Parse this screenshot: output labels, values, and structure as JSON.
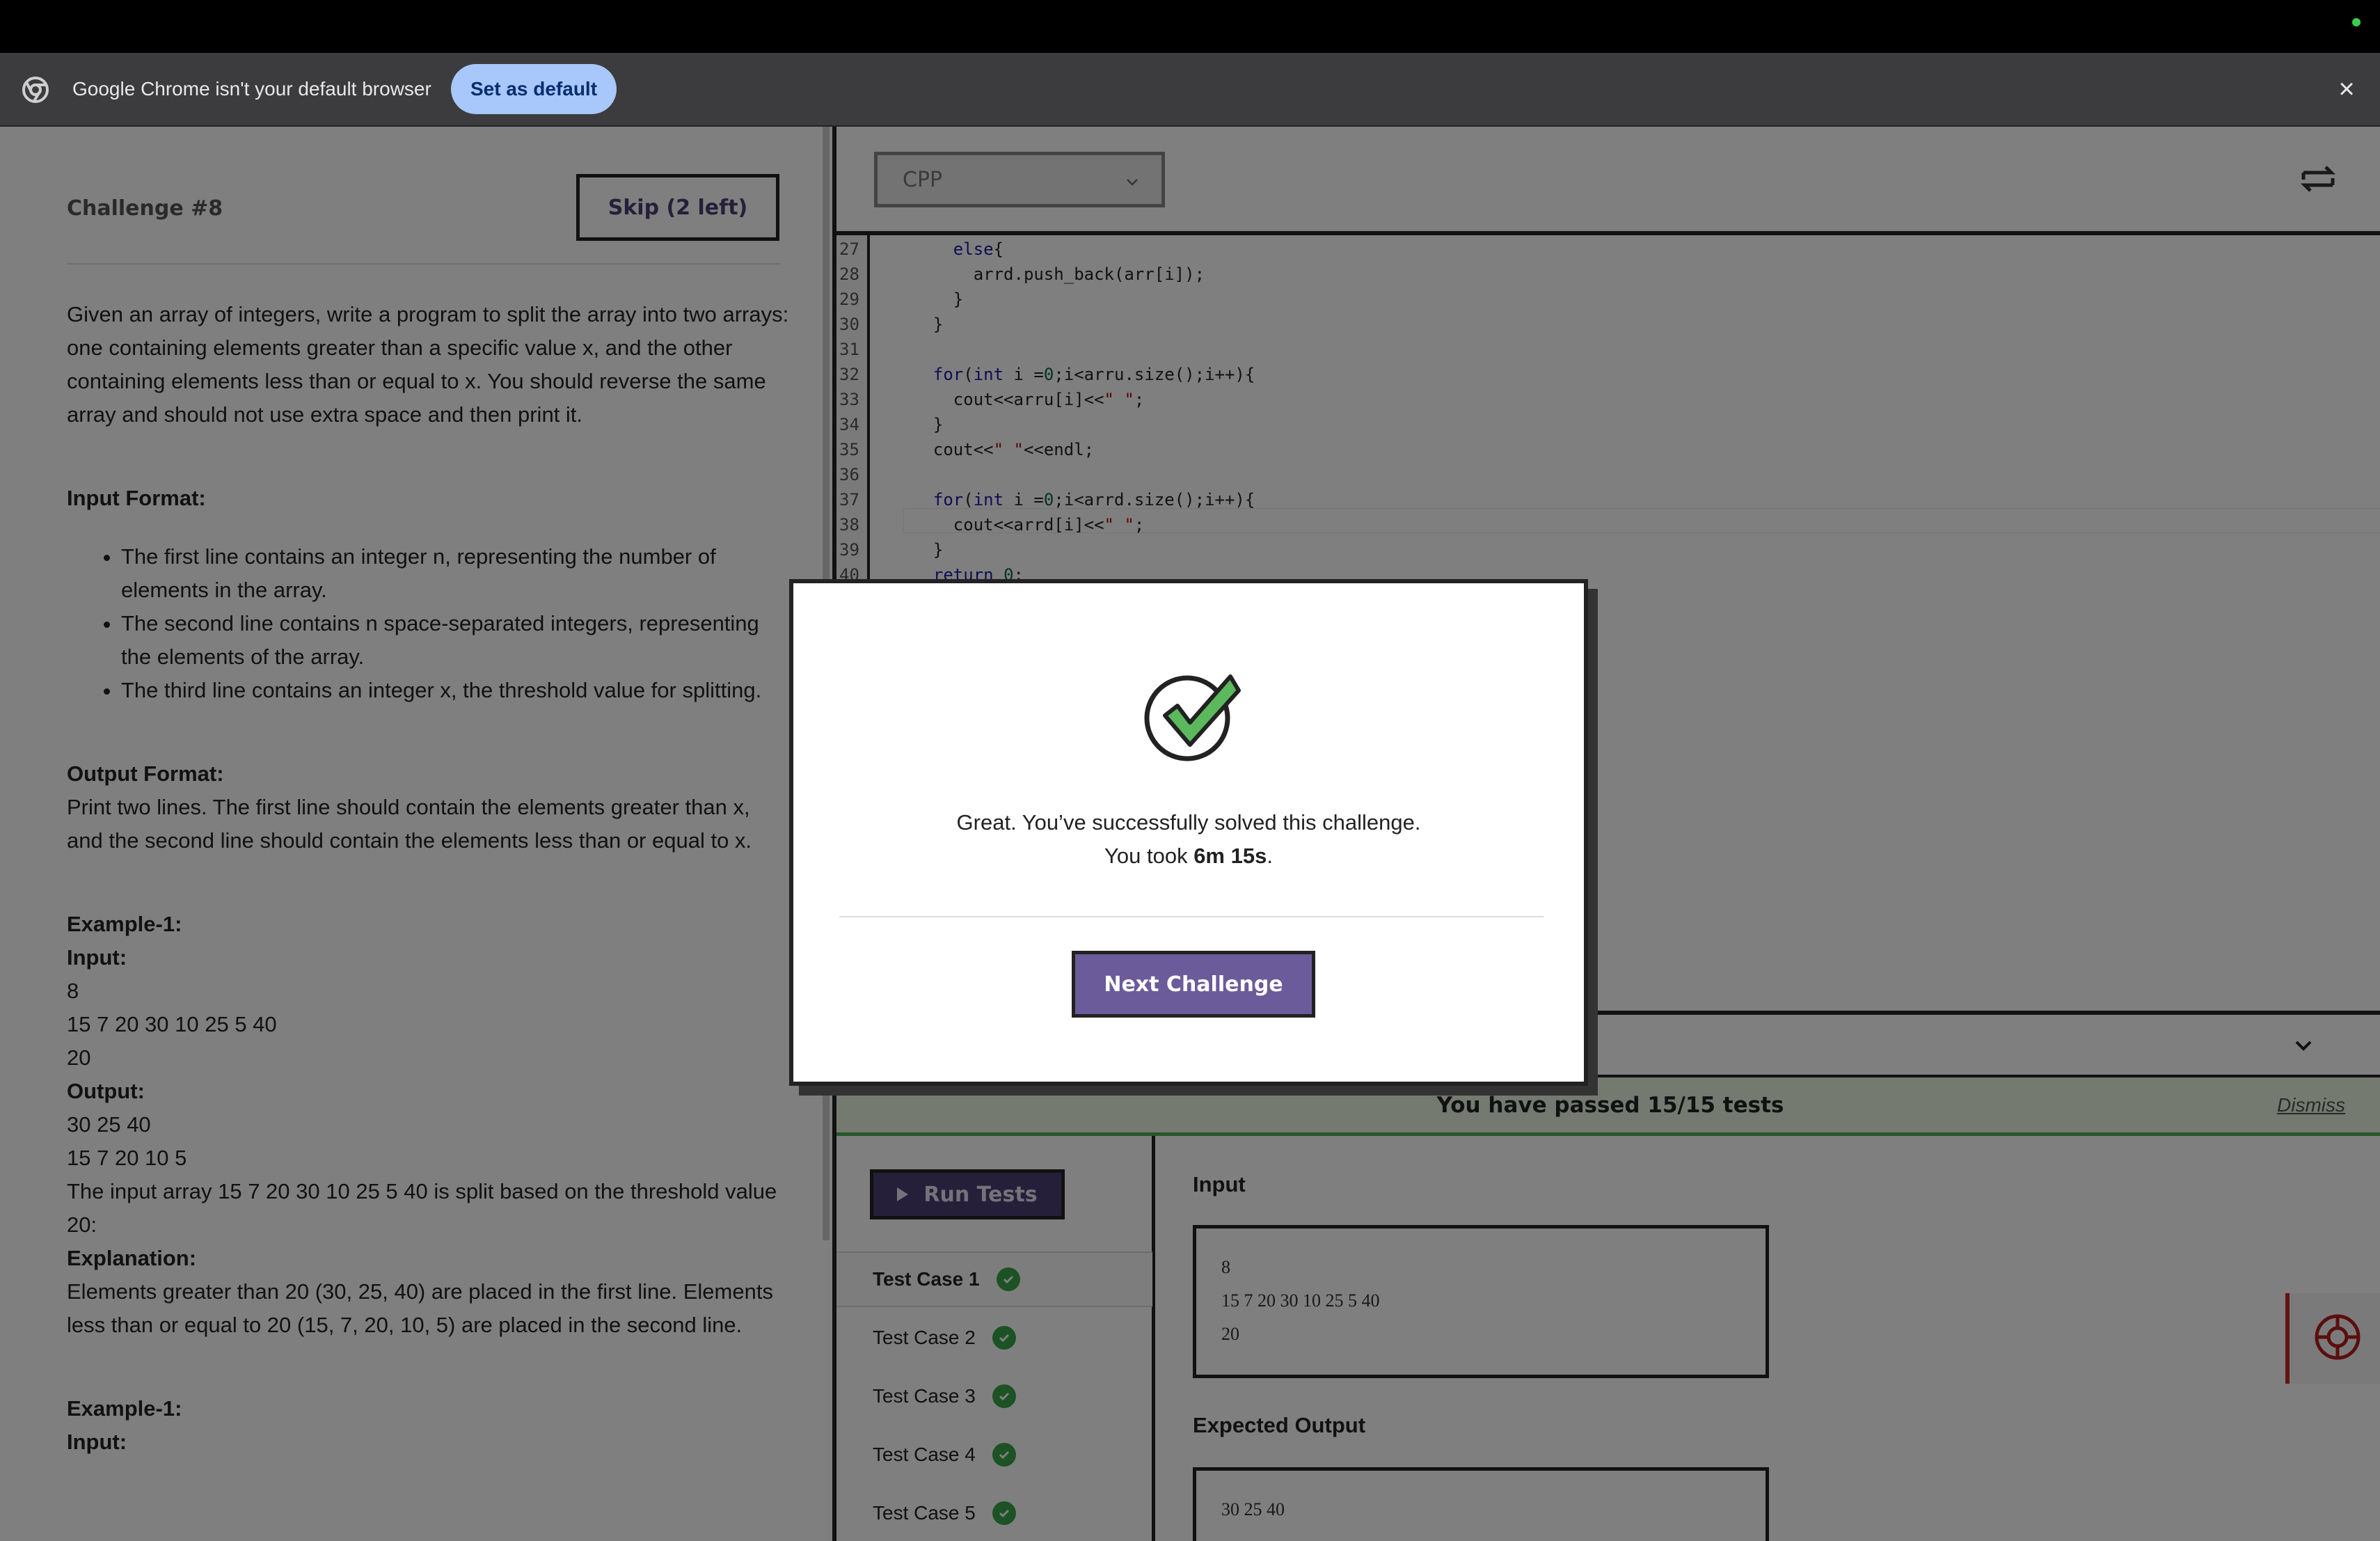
{
  "infobar": {
    "message": "Google Chrome isn't your default browser",
    "set_default_label": "Set as default",
    "close_icon": "close-icon"
  },
  "challenge": {
    "title": "Challenge #8",
    "skip_label": "Skip (2 left)",
    "description": "Given an array of integers, write a program to split the array into two arrays: one containing elements greater than a specific value x, and the other containing elements less than or equal to x. You should reverse the same array and should not use extra space and then print it.",
    "input_format_heading": "Input Format:",
    "input_format_items": [
      "The first line contains an integer n, representing the number of elements in the array.",
      "The second line contains n space-separated integers, representing the elements of the array.",
      "The third line contains an integer x, the threshold value for splitting."
    ],
    "output_format_heading": "Output Format:",
    "output_format_text": "Print two lines. The first line should contain the elements greater than x, and the second line should contain the elements less than or equal to x.",
    "example1_heading": "Example-1:",
    "example1_input_label": "Input:",
    "example1_input_lines": [
      "8",
      "15 7 20 30 10 25 5 40",
      "20"
    ],
    "example1_output_label": "Output:",
    "example1_output_lines": [
      "30 25 40",
      "15 7 20 10 5"
    ],
    "example1_note": "The input array 15 7 20 30 10 25 5 40 is split based on the threshold value 20:",
    "explanation_label": "Explanation:",
    "explanation_text": "Elements greater than 20 (30, 25, 40) are placed in the first line. Elements less than or equal to 20 (15, 7, 20, 10, 5) are placed in the second line.",
    "example2_heading": "Example-1:",
    "example2_input_label": "Input:"
  },
  "editor": {
    "language": "CPP",
    "lines": [
      {
        "num": "27",
        "code": "    else{"
      },
      {
        "num": "28",
        "code": "      arrd.push_back(arr[i]);"
      },
      {
        "num": "29",
        "code": "    }"
      },
      {
        "num": "30",
        "code": "  }"
      },
      {
        "num": "31",
        "code": ""
      },
      {
        "num": "32",
        "code": "  for(int i =0;i<arru.size();i++){"
      },
      {
        "num": "33",
        "code": "    cout<<arru[i]<<\" \";"
      },
      {
        "num": "34",
        "code": "  }"
      },
      {
        "num": "35",
        "code": "  cout<<\" \"<<endl;"
      },
      {
        "num": "36",
        "code": ""
      },
      {
        "num": "37",
        "code": "  for(int i =0;i<arrd.size();i++){"
      },
      {
        "num": "38",
        "code": "    cout<<arrd[i]<<\" \";"
      },
      {
        "num": "39",
        "code": "  }"
      },
      {
        "num": "40",
        "code": "  return 0;"
      }
    ]
  },
  "results": {
    "pass_message": "You have passed 15/15 tests",
    "dismiss_label": "Dismiss",
    "run_tests_label": "Run Tests",
    "test_cases": [
      "Test Case 1",
      "Test Case 2",
      "Test Case 3",
      "Test Case 4",
      "Test Case 5"
    ],
    "input_label": "Input",
    "input_lines": [
      "8",
      "15 7 20 30 10 25 5 40",
      "20"
    ],
    "expected_output_label": "Expected Output",
    "expected_output_lines": [
      "30 25 40"
    ]
  },
  "modal": {
    "message_line1": "Great. You’ve successfully solved this challenge.",
    "message_line2_prefix": "You took ",
    "time_taken": "6m 15s",
    "message_line2_suffix": ".",
    "next_label": "Next Challenge"
  },
  "colors": {
    "accent": "#6c5b9a",
    "success": "#3aa449",
    "pass_banner": "#e8f4e0"
  }
}
